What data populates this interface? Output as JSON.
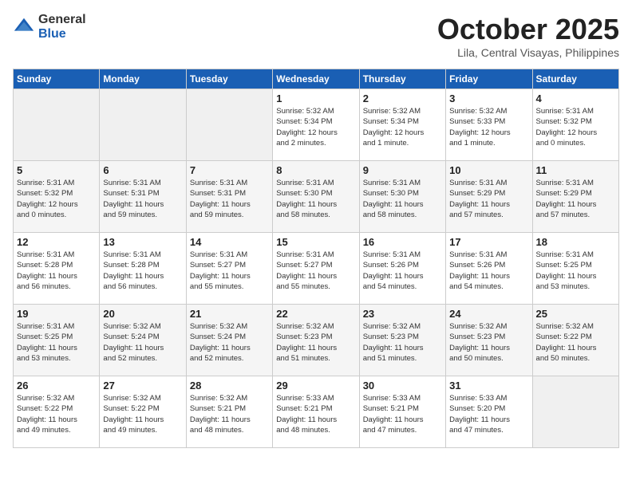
{
  "header": {
    "logo_general": "General",
    "logo_blue": "Blue",
    "month": "October 2025",
    "location": "Lila, Central Visayas, Philippines"
  },
  "weekdays": [
    "Sunday",
    "Monday",
    "Tuesday",
    "Wednesday",
    "Thursday",
    "Friday",
    "Saturday"
  ],
  "weeks": [
    [
      {
        "day": "",
        "info": ""
      },
      {
        "day": "",
        "info": ""
      },
      {
        "day": "",
        "info": ""
      },
      {
        "day": "1",
        "info": "Sunrise: 5:32 AM\nSunset: 5:34 PM\nDaylight: 12 hours\nand 2 minutes."
      },
      {
        "day": "2",
        "info": "Sunrise: 5:32 AM\nSunset: 5:34 PM\nDaylight: 12 hours\nand 1 minute."
      },
      {
        "day": "3",
        "info": "Sunrise: 5:32 AM\nSunset: 5:33 PM\nDaylight: 12 hours\nand 1 minute."
      },
      {
        "day": "4",
        "info": "Sunrise: 5:31 AM\nSunset: 5:32 PM\nDaylight: 12 hours\nand 0 minutes."
      }
    ],
    [
      {
        "day": "5",
        "info": "Sunrise: 5:31 AM\nSunset: 5:32 PM\nDaylight: 12 hours\nand 0 minutes."
      },
      {
        "day": "6",
        "info": "Sunrise: 5:31 AM\nSunset: 5:31 PM\nDaylight: 11 hours\nand 59 minutes."
      },
      {
        "day": "7",
        "info": "Sunrise: 5:31 AM\nSunset: 5:31 PM\nDaylight: 11 hours\nand 59 minutes."
      },
      {
        "day": "8",
        "info": "Sunrise: 5:31 AM\nSunset: 5:30 PM\nDaylight: 11 hours\nand 58 minutes."
      },
      {
        "day": "9",
        "info": "Sunrise: 5:31 AM\nSunset: 5:30 PM\nDaylight: 11 hours\nand 58 minutes."
      },
      {
        "day": "10",
        "info": "Sunrise: 5:31 AM\nSunset: 5:29 PM\nDaylight: 11 hours\nand 57 minutes."
      },
      {
        "day": "11",
        "info": "Sunrise: 5:31 AM\nSunset: 5:29 PM\nDaylight: 11 hours\nand 57 minutes."
      }
    ],
    [
      {
        "day": "12",
        "info": "Sunrise: 5:31 AM\nSunset: 5:28 PM\nDaylight: 11 hours\nand 56 minutes."
      },
      {
        "day": "13",
        "info": "Sunrise: 5:31 AM\nSunset: 5:28 PM\nDaylight: 11 hours\nand 56 minutes."
      },
      {
        "day": "14",
        "info": "Sunrise: 5:31 AM\nSunset: 5:27 PM\nDaylight: 11 hours\nand 55 minutes."
      },
      {
        "day": "15",
        "info": "Sunrise: 5:31 AM\nSunset: 5:27 PM\nDaylight: 11 hours\nand 55 minutes."
      },
      {
        "day": "16",
        "info": "Sunrise: 5:31 AM\nSunset: 5:26 PM\nDaylight: 11 hours\nand 54 minutes."
      },
      {
        "day": "17",
        "info": "Sunrise: 5:31 AM\nSunset: 5:26 PM\nDaylight: 11 hours\nand 54 minutes."
      },
      {
        "day": "18",
        "info": "Sunrise: 5:31 AM\nSunset: 5:25 PM\nDaylight: 11 hours\nand 53 minutes."
      }
    ],
    [
      {
        "day": "19",
        "info": "Sunrise: 5:31 AM\nSunset: 5:25 PM\nDaylight: 11 hours\nand 53 minutes."
      },
      {
        "day": "20",
        "info": "Sunrise: 5:32 AM\nSunset: 5:24 PM\nDaylight: 11 hours\nand 52 minutes."
      },
      {
        "day": "21",
        "info": "Sunrise: 5:32 AM\nSunset: 5:24 PM\nDaylight: 11 hours\nand 52 minutes."
      },
      {
        "day": "22",
        "info": "Sunrise: 5:32 AM\nSunset: 5:23 PM\nDaylight: 11 hours\nand 51 minutes."
      },
      {
        "day": "23",
        "info": "Sunrise: 5:32 AM\nSunset: 5:23 PM\nDaylight: 11 hours\nand 51 minutes."
      },
      {
        "day": "24",
        "info": "Sunrise: 5:32 AM\nSunset: 5:23 PM\nDaylight: 11 hours\nand 50 minutes."
      },
      {
        "day": "25",
        "info": "Sunrise: 5:32 AM\nSunset: 5:22 PM\nDaylight: 11 hours\nand 50 minutes."
      }
    ],
    [
      {
        "day": "26",
        "info": "Sunrise: 5:32 AM\nSunset: 5:22 PM\nDaylight: 11 hours\nand 49 minutes."
      },
      {
        "day": "27",
        "info": "Sunrise: 5:32 AM\nSunset: 5:22 PM\nDaylight: 11 hours\nand 49 minutes."
      },
      {
        "day": "28",
        "info": "Sunrise: 5:32 AM\nSunset: 5:21 PM\nDaylight: 11 hours\nand 48 minutes."
      },
      {
        "day": "29",
        "info": "Sunrise: 5:33 AM\nSunset: 5:21 PM\nDaylight: 11 hours\nand 48 minutes."
      },
      {
        "day": "30",
        "info": "Sunrise: 5:33 AM\nSunset: 5:21 PM\nDaylight: 11 hours\nand 47 minutes."
      },
      {
        "day": "31",
        "info": "Sunrise: 5:33 AM\nSunset: 5:20 PM\nDaylight: 11 hours\nand 47 minutes."
      },
      {
        "day": "",
        "info": ""
      }
    ]
  ]
}
